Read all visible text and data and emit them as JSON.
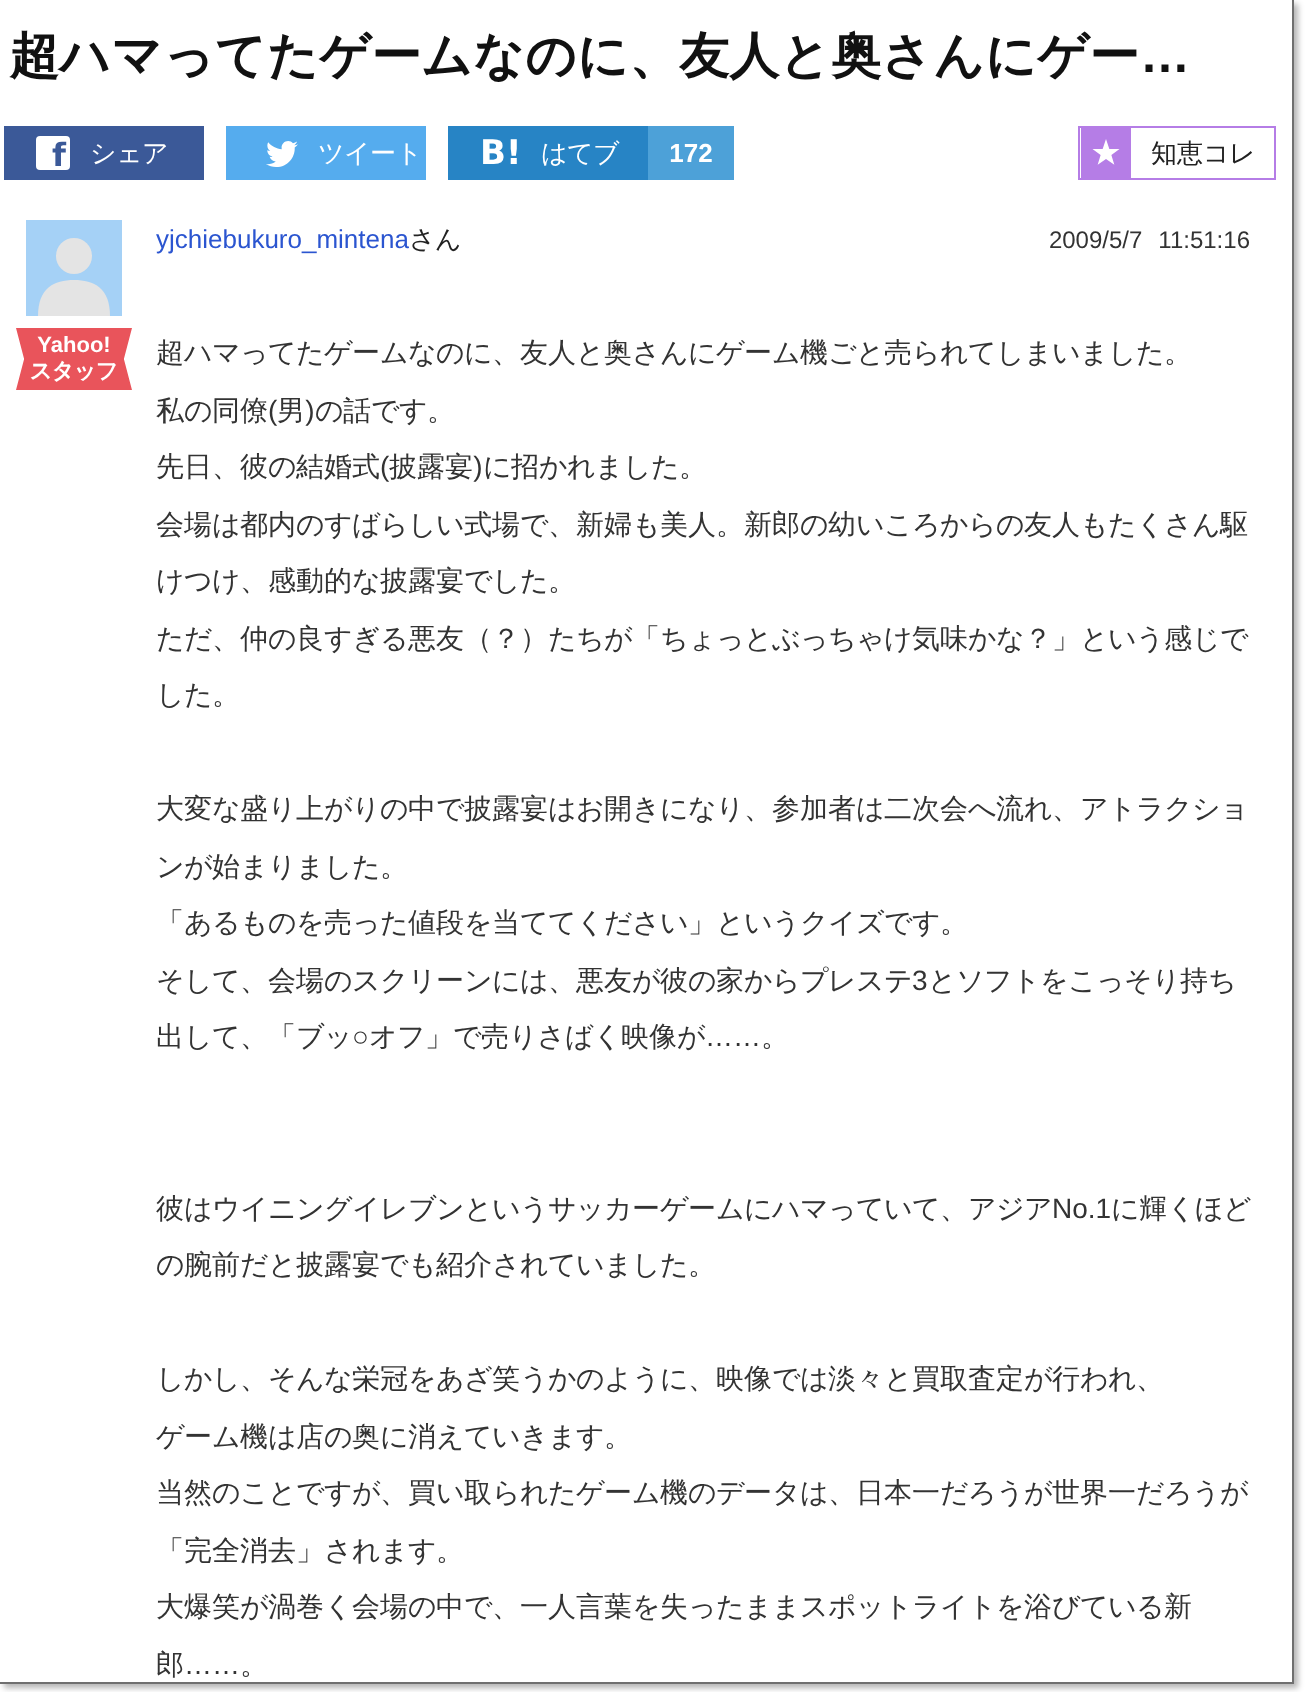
{
  "title": "超ハマってたゲームなのに、友人と奥さんにゲー…",
  "share_buttons": [
    {
      "kind": "facebook",
      "icon_text": "f",
      "label": "シェア"
    },
    {
      "kind": "twitter",
      "label": "ツイート"
    },
    {
      "kind": "hatena",
      "icon_text": "B!",
      "label": "はてブ",
      "count": "172"
    }
  ],
  "collect_button": {
    "label": "知恵コレ"
  },
  "post": {
    "badge": [
      "Yahoo!",
      "スタッフ"
    ],
    "author": "yjchiebukuro_mintena",
    "author_suffix": "さん",
    "date": "2009/5/7",
    "time": "11:51:16",
    "paragraphs": [
      [
        "超ハマってたゲームなのに、友人と奥さんにゲーム機ごと売られてしまいました。",
        "私の同僚(男)の話です。",
        "先日、彼の結婚式(披露宴)に招かれました。",
        "会場は都内のすばらしい式場で、新婦も美人。新郎の幼いころからの友人もたくさん駆けつけ、感動的な披露宴でした。",
        "ただ、仲の良すぎる悪友（？）たちが「ちょっとぶっちゃけ気味かな？」という感じでした。"
      ],
      [
        "大変な盛り上がりの中で披露宴はお開きになり、参加者は二次会へ流れ、アトラクションが始まりました。",
        "「あるものを売った値段を当ててください」というクイズです。",
        "そして、会場のスクリーンには、悪友が彼の家からプレステ3とソフトをこっそり持ち出して、「ブッ○オフ」で売りさばく映像が……。"
      ],
      [
        "彼はウイニングイレブンというサッカーゲームにハマっていて、アジアNo.1に輝くほどの腕前だと披露宴でも紹介されていました。"
      ],
      [
        "しかし、そんな栄冠をあざ笑うかのように、映像では淡々と買取査定が行われ、",
        "ゲーム機は店の奥に消えていきます。",
        "当然のことですが、買い取られたゲーム機のデータは、日本一だろうが世界一だろうが「完全消去」されます。",
        "大爆笑が渦巻く会場の中で、一人言葉を失ったままスポットライトを浴びている新郎……。"
      ]
    ]
  }
}
